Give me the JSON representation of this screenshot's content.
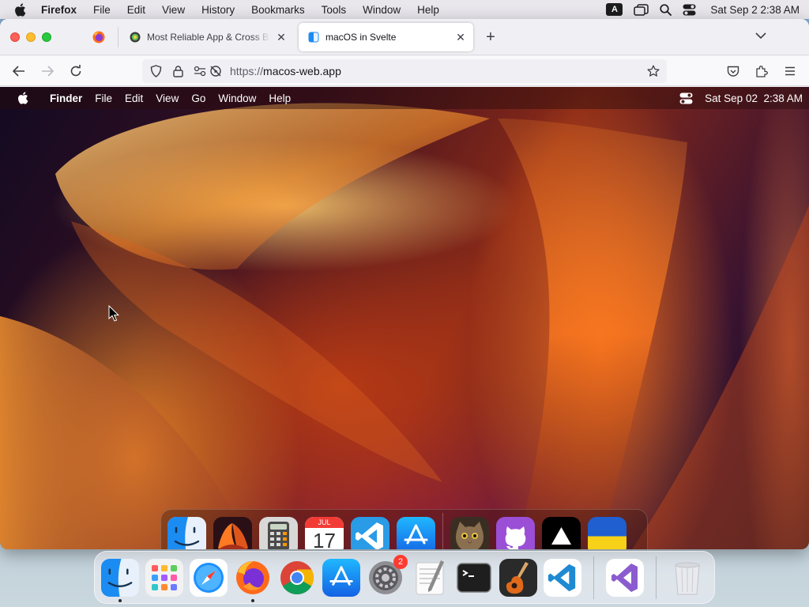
{
  "host_menubar": {
    "app_name": "Firefox",
    "menus": [
      "File",
      "Edit",
      "View",
      "History",
      "Bookmarks",
      "Tools",
      "Window",
      "Help"
    ],
    "input_source": "A",
    "clock": "Sat Sep 2  2:38 AM"
  },
  "browser": {
    "tabs": [
      {
        "title": "Most Reliable App & Cross Brow",
        "favicon": "lambdatest-icon",
        "active": false
      },
      {
        "title": "macOS in Svelte",
        "favicon": "macos-web-icon",
        "active": true
      }
    ],
    "url": {
      "scheme": "https://",
      "host": "macos-web.app"
    }
  },
  "emulated_desktop": {
    "menubar": {
      "app_name": "Finder",
      "menus": [
        "File",
        "Edit",
        "View",
        "Go",
        "Window",
        "Help"
      ],
      "clock": "Sat Sep 02  2:38 AM"
    },
    "dock": [
      {
        "name": "finder",
        "running": true
      },
      {
        "name": "wallpapers",
        "running": false
      },
      {
        "name": "calculator",
        "running": false
      },
      {
        "name": "calendar",
        "running": false,
        "month": "JUL",
        "day": "17"
      },
      {
        "name": "vscode",
        "running": false
      },
      {
        "name": "app-store",
        "running": false
      },
      {
        "name": "purus-twitter",
        "running": false
      },
      {
        "name": "github",
        "running": true
      },
      {
        "name": "vercel",
        "running": true
      },
      {
        "name": "ukraine",
        "running": true
      }
    ]
  },
  "host_dock": [
    {
      "name": "finder",
      "running": true
    },
    {
      "name": "launchpad",
      "running": false
    },
    {
      "name": "safari",
      "running": false
    },
    {
      "name": "firefox",
      "running": true
    },
    {
      "name": "chrome",
      "running": false
    },
    {
      "name": "app-store",
      "running": false
    },
    {
      "name": "system-settings",
      "running": false,
      "badge": "2"
    },
    {
      "name": "textedit",
      "running": false
    },
    {
      "name": "terminal",
      "running": false
    },
    {
      "name": "garageband",
      "running": false
    },
    {
      "name": "vscode",
      "running": false
    },
    {
      "name": "visual-studio",
      "running": false
    },
    {
      "name": "trash",
      "running": false
    }
  ]
}
